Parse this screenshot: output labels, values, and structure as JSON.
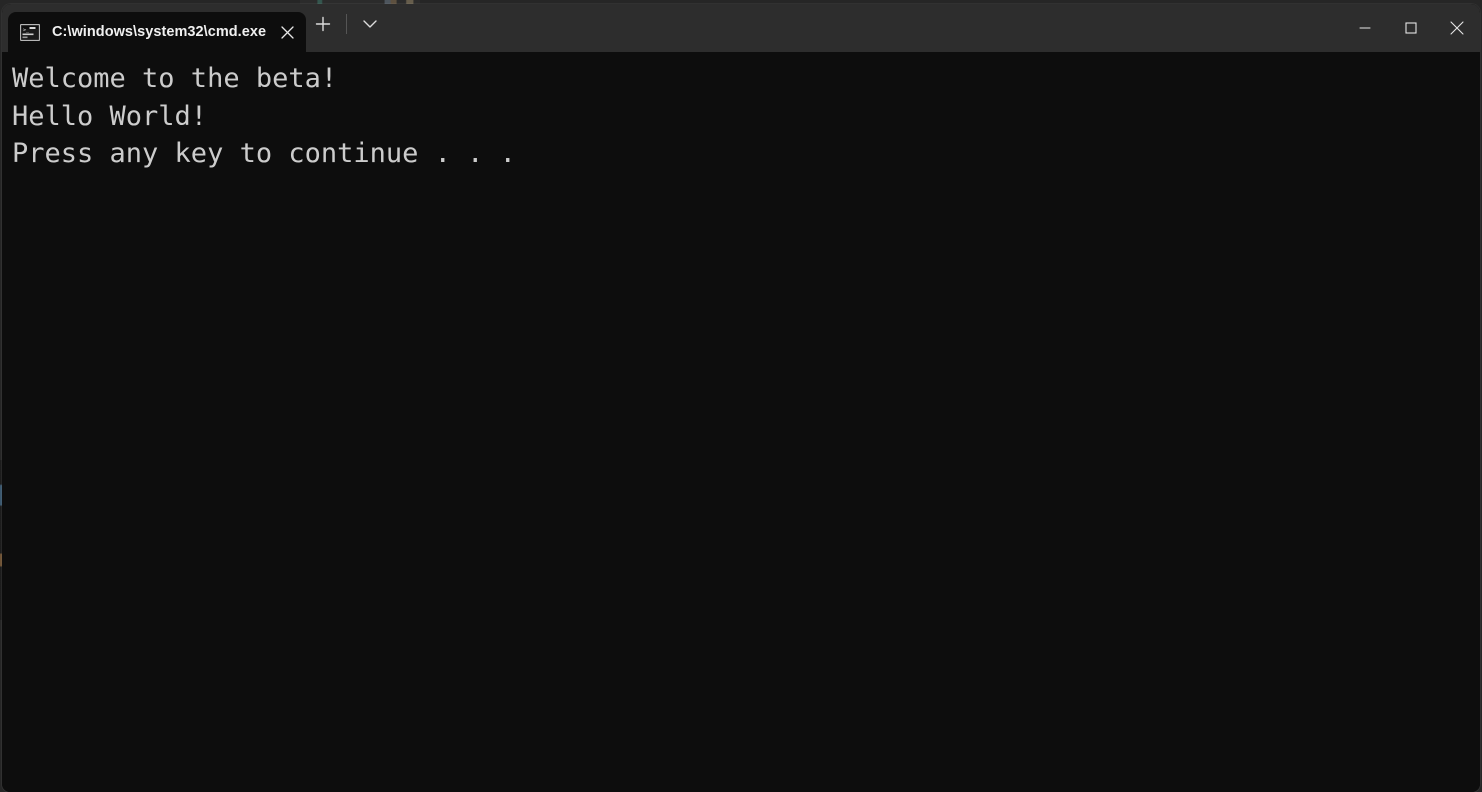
{
  "window": {
    "title": "C:\\windows\\system32\\cmd.exe",
    "colors": {
      "titlebar_bg": "#2d2d2d",
      "terminal_bg": "#0d0d0d",
      "terminal_fg": "#cccccc",
      "tab_active_bg": "#0d0d0d",
      "close_hover": "#c42b1c"
    }
  },
  "tabs": [
    {
      "label": "C:\\windows\\system32\\cmd.exe",
      "icon": "cmd-console-icon",
      "close_label": "✕",
      "active": true
    }
  ],
  "tab_actions": {
    "new_tab_label": "+",
    "dropdown_label": "⌄"
  },
  "window_controls": {
    "minimize_label": "—",
    "maximize_label": "□",
    "close_label": "✕"
  },
  "terminal": {
    "lines": [
      "Welcome to the beta!",
      "Hello World!",
      "Press any key to continue . . ."
    ],
    "text": "Welcome to the beta!\nHello World!\nPress any key to continue . . ."
  }
}
